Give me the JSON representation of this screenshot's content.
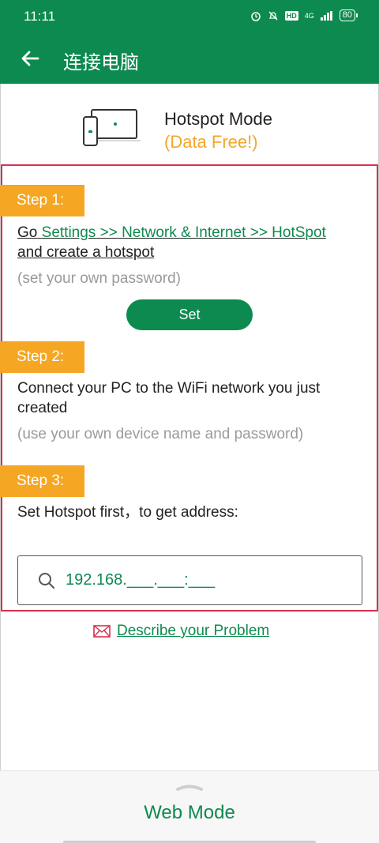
{
  "status_bar": {
    "time": "11:11",
    "network": "4G",
    "battery": "80"
  },
  "app_bar": {
    "title": "连接电脑"
  },
  "hotspot_header": {
    "title": "Hotspot Mode",
    "subtitle": "(Data Free!)"
  },
  "step1": {
    "label": "Step 1:",
    "go": "Go",
    "settings": "Settings",
    "sep1": ">>",
    "network_internet": "Network & Internet",
    "sep2": ">>",
    "hotspot": "HotSpot",
    "line2": "and create a hotspot",
    "hint": "(set your own password)",
    "button": "Set"
  },
  "step2": {
    "label": "Step 2:",
    "line1": "Connect your PC to the WiFi network you just",
    "line2": "created",
    "hint": "(use your own device name and password)"
  },
  "step3": {
    "label": "Step 3:",
    "text": "Set Hotspot first，to get address:"
  },
  "address": {
    "value": "192.168.___.___:___"
  },
  "describe_problem": {
    "label": "Describe your Problem"
  },
  "bottom_sheet": {
    "label": "Web Mode"
  },
  "colors": {
    "primary": "#0d8a4f",
    "accent": "#f5a623",
    "border_highlight": "#d9304f"
  }
}
